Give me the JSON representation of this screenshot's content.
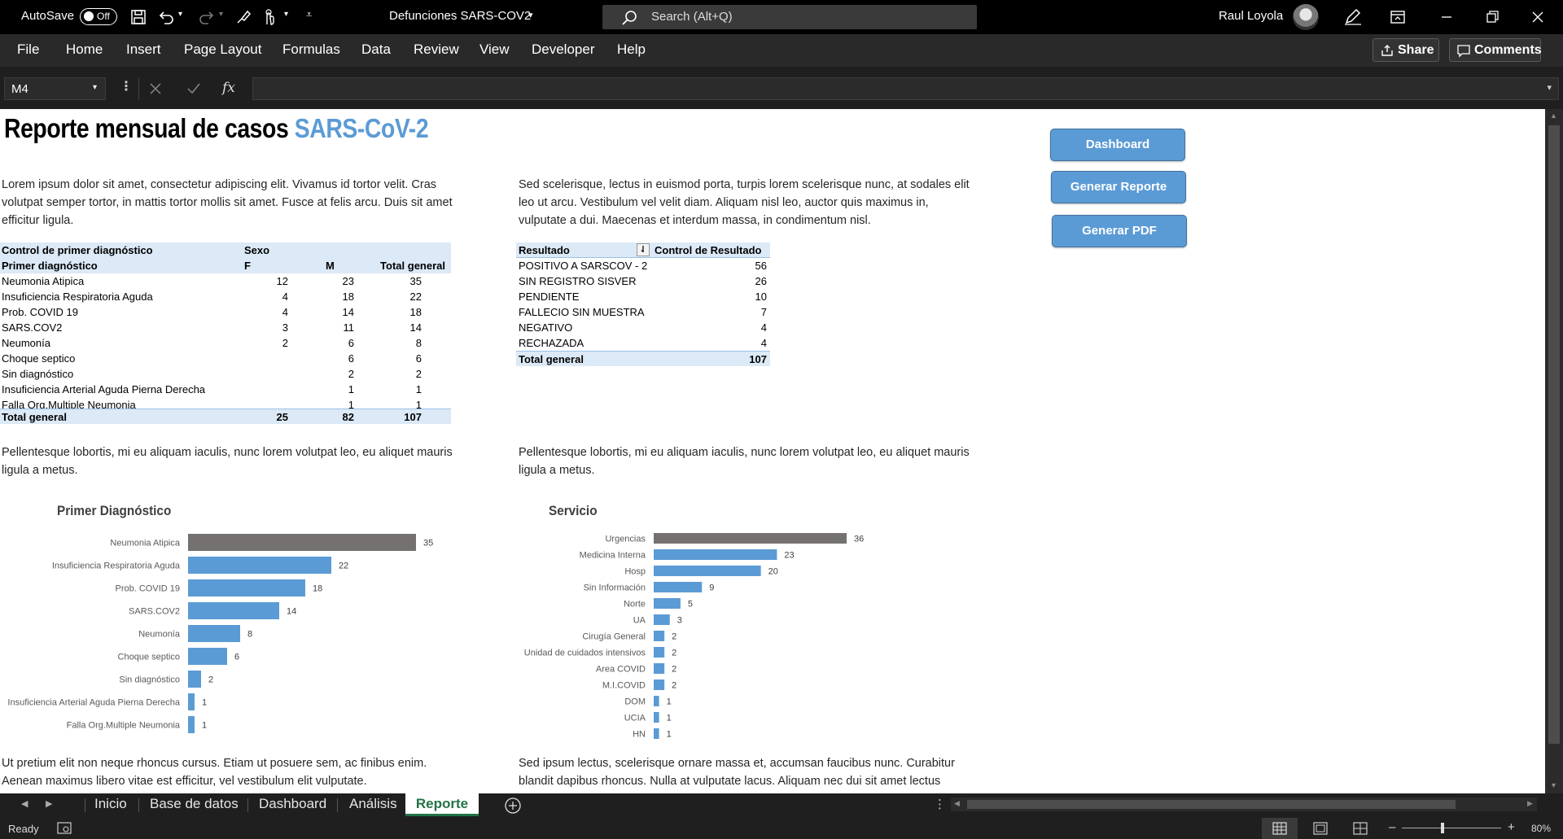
{
  "titlebar": {
    "autosave_label": "AutoSave",
    "autosave_state": "Off",
    "document_title": "Defunciones SARS-COV2",
    "search_placeholder": "Search (Alt+Q)",
    "user_name": "Raul Loyola"
  },
  "menu": {
    "items": [
      "File",
      "Home",
      "Insert",
      "Page Layout",
      "Formulas",
      "Data",
      "Review",
      "View",
      "Developer",
      "Help"
    ],
    "share_label": "Share",
    "comments_label": "Comments"
  },
  "formula_bar": {
    "cell_ref": "M4",
    "fx_label": "fx",
    "value": ""
  },
  "sheet": {
    "title_main": "Reporte mensual de casos ",
    "title_accent": "SARS-CoV-2",
    "accent_color": "#5b9bd5",
    "para1": "Lorem ipsum dolor sit amet, consectetur adipiscing elit. Vivamus id tortor velit. Cras volutpat semper tortor, in mattis tortor mollis sit amet. Fusce at felis arcu. Duis sit amet efficitur ligula.",
    "para2": "Sed scelerisque, lectus in euismod porta, turpis lorem scelerisque nunc, at sodales elit leo ut arcu. Vestibulum vel velit diam. Aliquam nisl leo, auctor quis maximus in, vulputate a dui. Maecenas et interdum massa, in condimentum nisl.",
    "para3": "Pellentesque lobortis, mi eu aliquam iaculis, nunc lorem volutpat leo, eu aliquet mauris ligula a metus.",
    "para4": "Pellentesque lobortis, mi eu aliquam iaculis, nunc lorem volutpat leo, eu aliquet mauris ligula a metus.",
    "para5": "Ut pretium elit non neque rhoncus cursus. Etiam ut posuere sem, ac finibus enim. Aenean maximus libero vitae est efficitur, vel vestibulum elit vulputate.",
    "para6": "Sed ipsum lectus, scelerisque ornare massa et, accumsan faucibus nunc. Curabitur blandit dapibus rhoncus. Nulla at vulputate lacus. Aliquam nec dui sit amet lectus",
    "buttons": {
      "dashboard": "Dashboard",
      "generar_reporte": "Generar Reporte",
      "generar_pdf": "Generar PDF"
    }
  },
  "pivot_diagnostico": {
    "header1": {
      "label": "Control de primer diagnóstico",
      "col": "Sexo"
    },
    "header2": {
      "label": "Primer diagnóstico",
      "f": "F",
      "m": "M",
      "total": "Total general"
    },
    "rows": [
      {
        "label": "Neumonia Atipica",
        "f": "12",
        "m": "23",
        "total": "35"
      },
      {
        "label": "Insuficiencia Respiratoria Aguda",
        "f": "4",
        "m": "18",
        "total": "22"
      },
      {
        "label": "Prob. COVID 19",
        "f": "4",
        "m": "14",
        "total": "18"
      },
      {
        "label": "SARS.COV2",
        "f": "3",
        "m": "11",
        "total": "14"
      },
      {
        "label": "Neumonía",
        "f": "2",
        "m": "6",
        "total": "8"
      },
      {
        "label": "Choque septico",
        "f": "",
        "m": "6",
        "total": "6"
      },
      {
        "label": "Sin diagnóstico",
        "f": "",
        "m": "2",
        "total": "2"
      },
      {
        "label": "Insuficiencia Arterial Aguda Pierna Derecha",
        "f": "",
        "m": "1",
        "total": "1"
      },
      {
        "label": "Falla Org.Multiple Neumonia",
        "f": "",
        "m": "1",
        "total": "1"
      }
    ],
    "total": {
      "label": "Total general",
      "f": "25",
      "m": "82",
      "total": "107"
    }
  },
  "pivot_resultado": {
    "header": {
      "label": "Resultado",
      "value": "Control de Resultado"
    },
    "rows": [
      {
        "label": "POSITIVO  A SARSCOV - 2",
        "value": "56"
      },
      {
        "label": "SIN REGISTRO SISVER",
        "value": "26"
      },
      {
        "label": "PENDIENTE",
        "value": "10"
      },
      {
        "label": "FALLECIO SIN MUESTRA",
        "value": "7"
      },
      {
        "label": "NEGATIVO",
        "value": "4"
      },
      {
        "label": "RECHAZADA",
        "value": "4"
      }
    ],
    "total": {
      "label": "Total general",
      "value": "107"
    }
  },
  "chart_data": [
    {
      "type": "bar",
      "orientation": "horizontal",
      "title": "Primer Diagnóstico",
      "categories": [
        "Neumonia Atipica",
        "Insuficiencia Respiratoria Aguda",
        "Prob. COVID 19",
        "SARS.COV2",
        "Neumonía",
        "Choque septico",
        "Sin diagnóstico",
        "Insuficiencia Arterial Aguda Pierna Derecha",
        "Falla Org.Multiple Neumonia"
      ],
      "values": [
        35,
        22,
        18,
        14,
        8,
        6,
        2,
        1,
        1
      ],
      "highlight_index": 0,
      "bar_color": "#5b9bd5",
      "highlight_color": "#767171",
      "grid": false
    },
    {
      "type": "bar",
      "orientation": "horizontal",
      "title": "Servicio",
      "categories": [
        "Urgencias",
        "Medicina Interna",
        "Hosp",
        "Sin Información",
        "Norte",
        "UA",
        "Cirugía General",
        "Unidad de cuidados intensivos",
        "Area COVID",
        "M.I.COVID",
        "DOM",
        "UCIA",
        "HN"
      ],
      "values": [
        36,
        23,
        20,
        9,
        5,
        3,
        2,
        2,
        2,
        2,
        1,
        1,
        1
      ],
      "highlight_index": 0,
      "bar_color": "#5b9bd5",
      "highlight_color": "#767171",
      "grid": false
    }
  ],
  "tabs": {
    "items": [
      "Inicio",
      "Base de datos",
      "Dashboard",
      "Análisis",
      "Reporte"
    ],
    "active": "Reporte"
  },
  "status": {
    "ready": "Ready",
    "zoom": "80%"
  }
}
